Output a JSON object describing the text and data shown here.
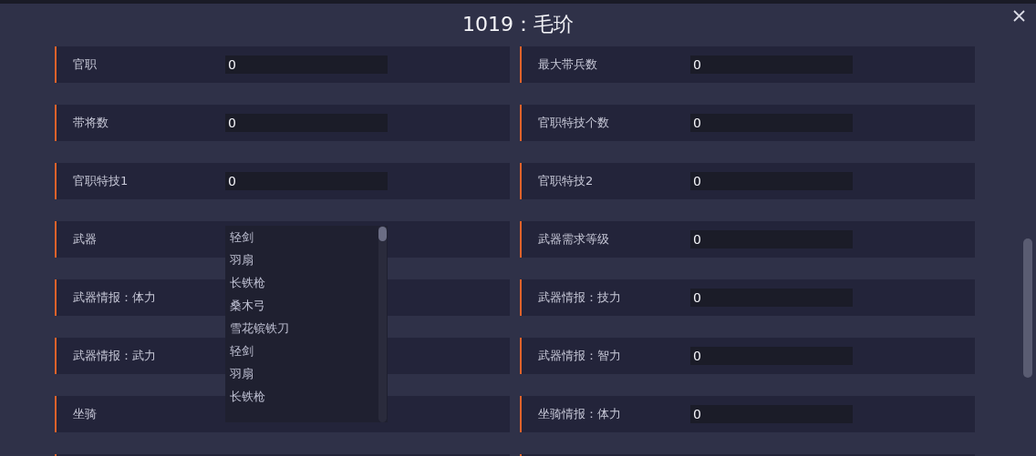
{
  "title": "1019：毛玠",
  "fields": [
    {
      "kind": "input",
      "label": "官职",
      "value": "0"
    },
    {
      "kind": "input",
      "label": "最大带兵数",
      "value": "0"
    },
    {
      "kind": "input",
      "label": "带将数",
      "value": "0"
    },
    {
      "kind": "input",
      "label": "官职特技个数",
      "value": "0"
    },
    {
      "kind": "input",
      "label": "官职特技1",
      "value": "0"
    },
    {
      "kind": "input",
      "label": "官职特技2",
      "value": "0"
    },
    {
      "kind": "dropdown",
      "label": "武器",
      "options": [
        "轻剑",
        "羽扇",
        "长铁枪",
        "桑木弓",
        "雪花镔铁刀",
        "轻剑",
        "羽扇",
        "长铁枪"
      ]
    },
    {
      "kind": "input",
      "label": "武器需求等级",
      "value": "0"
    },
    {
      "kind": "covered",
      "label": "武器情报：体力"
    },
    {
      "kind": "input",
      "label": "武器情报：技力",
      "value": "0"
    },
    {
      "kind": "covered",
      "label": "武器情报：武力"
    },
    {
      "kind": "input",
      "label": "武器情报：智力",
      "value": "0"
    },
    {
      "kind": "covered",
      "label": "坐骑"
    },
    {
      "kind": "input",
      "label": "坐骑情报：体力",
      "value": "0"
    },
    {
      "kind": "blank"
    },
    {
      "kind": "blank"
    }
  ]
}
